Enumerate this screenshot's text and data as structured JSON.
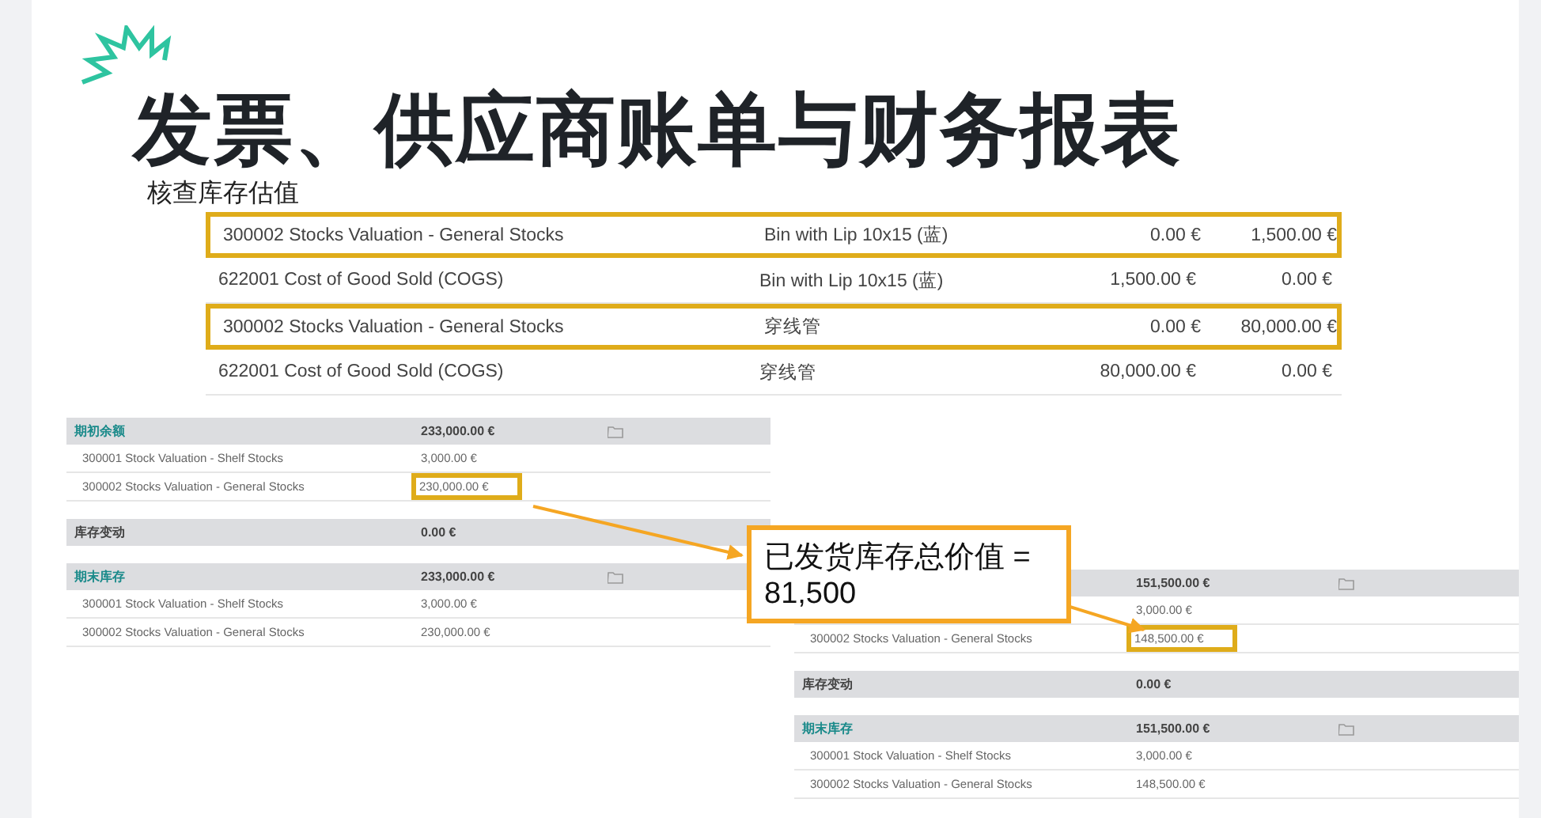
{
  "title": "发票、供应商账单与财务报表",
  "subtitle": "核查库存估值",
  "entries": [
    {
      "account": "300002 Stocks Valuation - General Stocks",
      "product": "Bin with Lip 10x15 (蓝)",
      "debit": "0.00 €",
      "credit": "1,500.00 €",
      "highlighted": true
    },
    {
      "account": "622001 Cost of Good Sold (COGS)",
      "product": "Bin with Lip 10x15 (蓝)",
      "debit": "1,500.00 €",
      "credit": "0.00 €",
      "highlighted": false
    },
    {
      "account": "300002 Stocks Valuation - General Stocks",
      "product": "穿线管",
      "debit": "0.00 €",
      "credit": "80,000.00 €",
      "highlighted": true
    },
    {
      "account": "622001 Cost of Good Sold (COGS)",
      "product": "穿线管",
      "debit": "80,000.00 €",
      "credit": "0.00 €",
      "highlighted": false
    }
  ],
  "reports": [
    {
      "sections": [
        {
          "kind": "balance",
          "label": "期初余额",
          "value": "233,000.00 €",
          "rows": [
            {
              "label": "300001 Stock Valuation - Shelf Stocks",
              "value": "3,000.00 €",
              "highlighted": false
            },
            {
              "label": "300002 Stocks Valuation - General Stocks",
              "value": "230,000.00 €",
              "highlighted": true
            }
          ]
        },
        {
          "kind": "movement",
          "label": "库存变动",
          "value": "0.00 €"
        },
        {
          "kind": "balance",
          "label": "期末库存",
          "value": "233,000.00 €",
          "rows": [
            {
              "label": "300001 Stock Valuation - Shelf Stocks",
              "value": "3,000.00 €",
              "highlighted": false
            },
            {
              "label": "300002 Stocks Valuation - General Stocks",
              "value": "230,000.00 €",
              "highlighted": false
            }
          ]
        }
      ]
    },
    {
      "sections": [
        {
          "kind": "balance",
          "value": "151,500.00 €",
          "rows": [
            {
              "value": "3,000.00 €",
              "highlighted": false
            },
            {
              "label": "300002 Stocks Valuation - General Stocks",
              "value": "148,500.00 €",
              "highlighted": true
            }
          ]
        },
        {
          "kind": "movement",
          "label": "库存变动",
          "value": "0.00 €"
        },
        {
          "kind": "balance",
          "label": "期末库存",
          "value": "151,500.00 €",
          "rows": [
            {
              "label": "300001 Stock Valuation - Shelf Stocks",
              "value": "3,000.00 €",
              "highlighted": false
            },
            {
              "label": "300002 Stocks Valuation - General Stocks",
              "value": "148,500.00 €",
              "highlighted": false
            }
          ]
        }
      ]
    }
  ],
  "callout": {
    "lines": [
      "已发货库存总价值 =",
      "81,500"
    ]
  }
}
